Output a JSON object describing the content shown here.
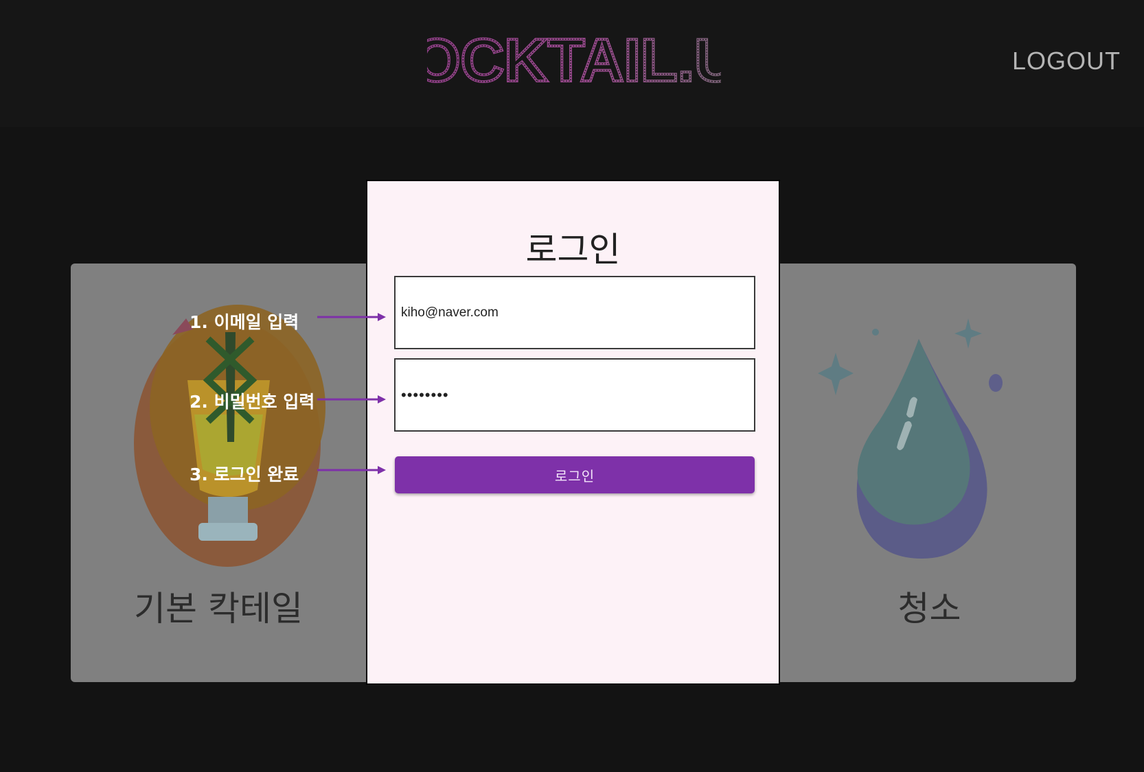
{
  "header": {
    "logo_text": "COCKTAIL.US",
    "logout_label": "LOGOUT"
  },
  "cards": {
    "left_label": "기본 칵테일",
    "right_label": "청소",
    "left_icon": "cocktail-glass-icon",
    "right_icon": "water-drop-icon"
  },
  "login_modal": {
    "title": "로그인",
    "email_value": "kiho@naver.com",
    "password_value": "••••••••",
    "submit_label": "로그인"
  },
  "annotations": {
    "step1": "1. 이메일 입력",
    "step2": "2. 비밀번호 입력",
    "step3": "3. 로그인 완료",
    "arrow_color": "#7e31a9"
  },
  "colors": {
    "background": "#131313",
    "modal_background": "#fdf2f7",
    "accent": "#7e31a9",
    "card_background": "#808080"
  }
}
